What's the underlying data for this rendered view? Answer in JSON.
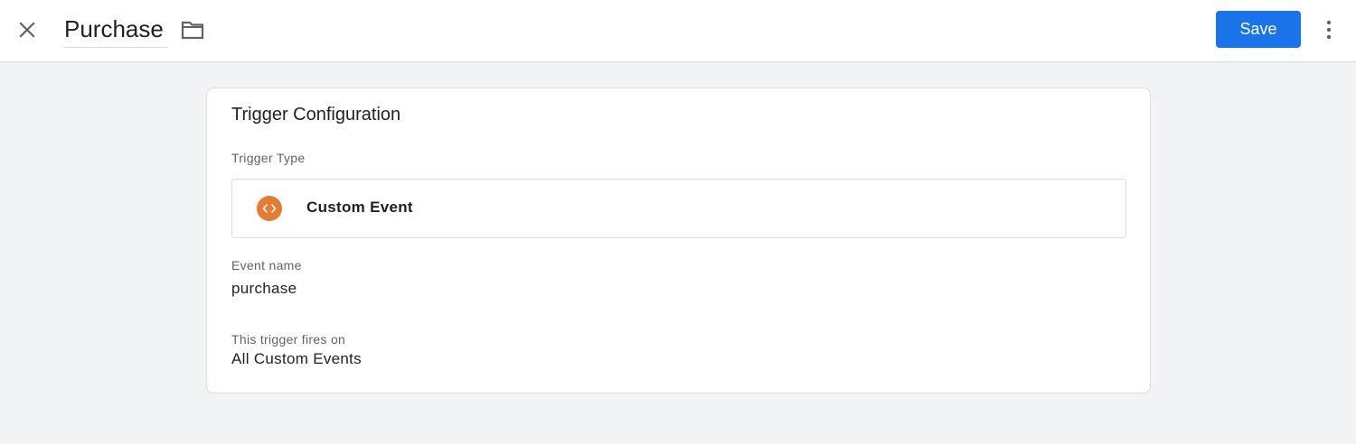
{
  "header": {
    "title_value": "Purchase",
    "save_label": "Save"
  },
  "card": {
    "title": "Trigger Configuration",
    "trigger_type_label": "Trigger Type",
    "trigger_type_value": "Custom Event",
    "trigger_type_icon": "code-brackets-icon",
    "trigger_type_icon_color": "#e37c34",
    "event_name_label": "Event name",
    "event_name_value": "purchase",
    "fires_on_label": "This trigger fires on",
    "fires_on_value": "All Custom Events"
  },
  "colors": {
    "accent": "#1a73e8",
    "background": "#f1f3f4",
    "border": "#dadce0"
  },
  "icons": {
    "close": "close-icon",
    "folder": "folder-icon",
    "more": "more-vert-icon"
  }
}
